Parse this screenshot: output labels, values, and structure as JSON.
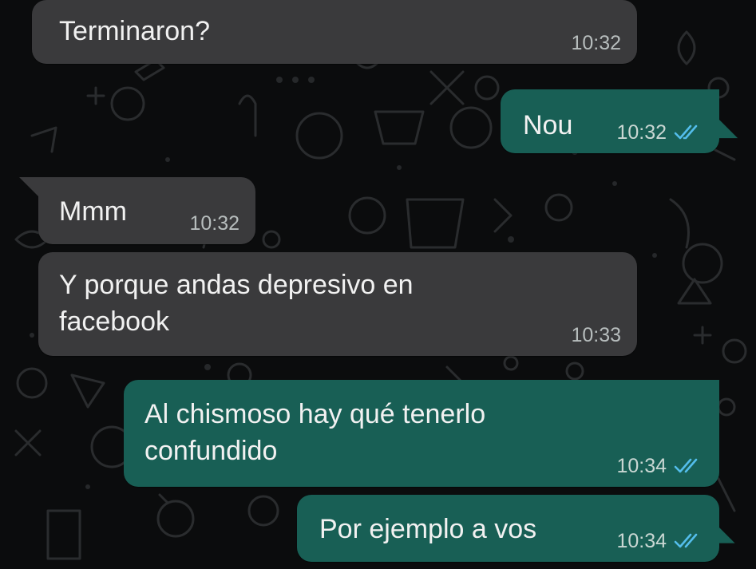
{
  "colors": {
    "background": "#0b0c0d",
    "incoming_bubble": "#3a3a3c",
    "outgoing_bubble": "#185f55",
    "text": "#f1f1f1",
    "timestamp": "#b7bdbd",
    "read_ticks": "#53bdeb"
  },
  "messages": [
    {
      "direction": "incoming",
      "lines": [
        "Terminaron?"
      ],
      "time": "10:32"
    },
    {
      "direction": "outgoing",
      "lines": [
        "Nou"
      ],
      "time": "10:32",
      "status": "read"
    },
    {
      "direction": "incoming",
      "lines": [
        "Mmm"
      ],
      "time": "10:32"
    },
    {
      "direction": "incoming",
      "lines": [
        "Y porque andas depresivo en",
        "facebook"
      ],
      "time": "10:33"
    },
    {
      "direction": "outgoing",
      "lines": [
        "Al chismoso hay qué tenerlo",
        "confundido"
      ],
      "time": "10:34",
      "status": "read"
    },
    {
      "direction": "outgoing",
      "lines": [
        "Por ejemplo a vos"
      ],
      "time": "10:34",
      "status": "read"
    }
  ]
}
